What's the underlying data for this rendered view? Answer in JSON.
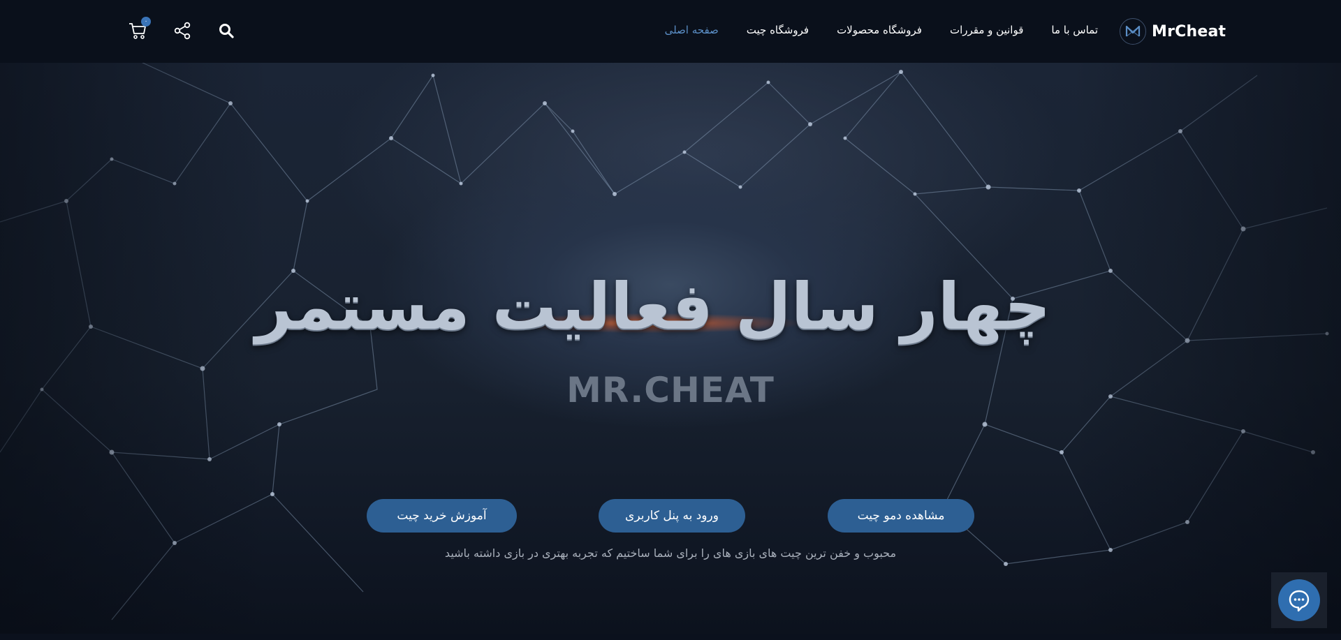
{
  "header": {
    "logo_text": "MrCheat",
    "nav": [
      {
        "label": "صفحه اصلی",
        "active": true
      },
      {
        "label": "فروشگاه چیت",
        "active": false
      },
      {
        "label": "فروشگاه محصولات",
        "active": false
      },
      {
        "label": "قوانین و مقررات",
        "active": false
      },
      {
        "label": "تماس با ما",
        "active": false
      }
    ],
    "cart_count": "۰",
    "icons": [
      "search-icon",
      "share-icon",
      "cart-icon"
    ]
  },
  "hero": {
    "title": "چهار سال فعالیت مستمر",
    "brand": "MR.CHEAT",
    "buttons": {
      "demo": "مشاهده دمو چیت",
      "panel": "ورود به پنل کاربری",
      "tutorial": "آموزش خرید چیت"
    },
    "subtitle": "محبوب و خفن ترین چیت های بازی های را برای شما ساختیم که تجربه بهتری در بازی داشته باشید"
  },
  "chat": {
    "icon": "chat-bubble-icon"
  },
  "colors": {
    "accent": "#5b8fc7",
    "button": "#2d5f93",
    "header_bg": "#0a101b",
    "chat_button": "#2f6eb0"
  }
}
